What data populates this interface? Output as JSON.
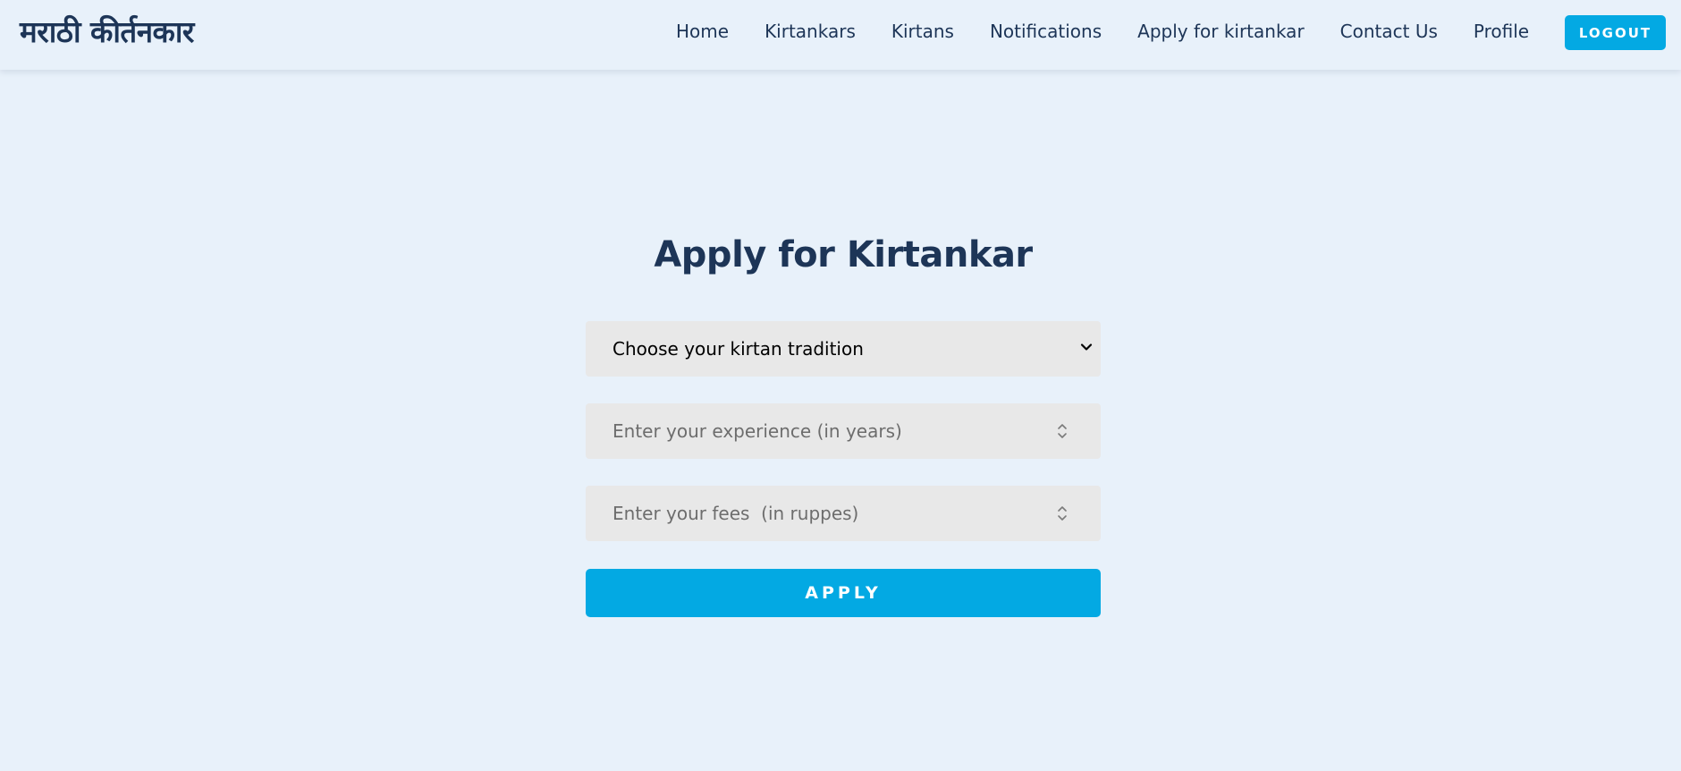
{
  "header": {
    "brand": "मराठी कीर्तनकार",
    "nav_items": [
      {
        "label": "Home"
      },
      {
        "label": "Kirtankars"
      },
      {
        "label": "Kirtans"
      },
      {
        "label": "Notifications"
      },
      {
        "label": "Apply for kirtankar"
      },
      {
        "label": "Contact Us"
      },
      {
        "label": "Profile"
      }
    ],
    "logout_label": "LOGOUT"
  },
  "main": {
    "title": "Apply for Kirtankar",
    "tradition_select": {
      "selected": "Choose your kirtan tradition",
      "icon": "chevron-down-icon"
    },
    "experience_input": {
      "placeholder": "Enter your experience (in years)",
      "value": ""
    },
    "fees_input": {
      "placeholder": "Enter your fees  (in ruppes)",
      "value": ""
    },
    "apply_label": "APPLY"
  },
  "colors": {
    "background": "#e8f1fa",
    "primary_text": "#1d3557",
    "accent": "#03a9e3",
    "field_background": "#e8e8e8",
    "placeholder_text": "#6d6d6d"
  }
}
